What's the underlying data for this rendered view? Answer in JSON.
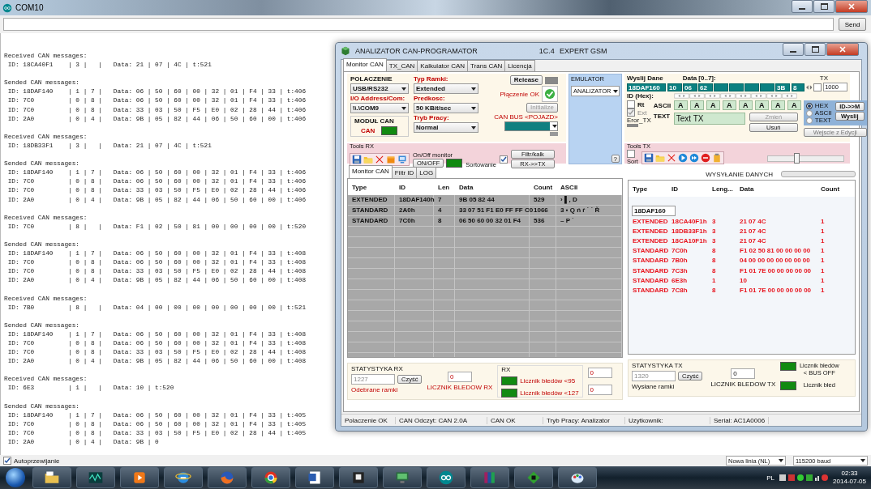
{
  "serial_monitor": {
    "title": "COM10",
    "send_button": "Send",
    "log": [
      {
        "header": "Received CAN messages:",
        "lines": [
          " ID: 18CA40F1    | 3 |   |   Data: 21 | 07 | 4C | t:521"
        ]
      },
      {
        "header": "Sended CAN messages:",
        "lines": [
          " ID: 18DAF140    | 1 | 7 |   Data: 06 | 50 | 60 | 00 | 32 | 01 | F4 | 33 | t:406",
          " ID: 7C0         | 0 | 8 |   Data: 06 | 50 | 60 | 00 | 32 | 01 | F4 | 33 | t:406",
          " ID: 7C0         | 0 | 8 |   Data: 33 | 03 | 50 | F5 | E0 | 02 | 28 | 44 | t:406",
          " ID: 2A0         | 0 | 4 |   Data: 9B | 05 | 82 | 44 | 06 | 50 | 60 | 00 | t:406"
        ]
      },
      {
        "header": "Received CAN messages:",
        "lines": [
          " ID: 18DB33F1    | 3 |   |   Data: 21 | 07 | 4C | t:521"
        ]
      },
      {
        "header": "Sended CAN messages:",
        "lines": [
          " ID: 18DAF140    | 1 | 7 |   Data: 06 | 50 | 60 | 00 | 32 | 01 | F4 | 33 | t:406",
          " ID: 7C0         | 0 | 8 |   Data: 06 | 50 | 60 | 00 | 32 | 01 | F4 | 33 | t:406",
          " ID: 7C0         | 0 | 8 |   Data: 33 | 03 | 50 | F5 | E0 | 02 | 28 | 44 | t:406",
          " ID: 2A0         | 0 | 4 |   Data: 9B | 05 | 82 | 44 | 06 | 50 | 60 | 00 | t:406"
        ]
      },
      {
        "header": "Received CAN messages:",
        "lines": [
          " ID: 7C0         | 8 |   |   Data: F1 | 02 | 50 | 81 | 00 | 00 | 00 | 00 | t:520"
        ]
      },
      {
        "header": "Sended CAN messages:",
        "lines": [
          " ID: 18DAF140    | 1 | 7 |   Data: 06 | 50 | 60 | 00 | 32 | 01 | F4 | 33 | t:408",
          " ID: 7C0         | 0 | 8 |   Data: 06 | 50 | 60 | 00 | 32 | 01 | F4 | 33 | t:408",
          " ID: 7C0         | 0 | 8 |   Data: 33 | 03 | 50 | F5 | E0 | 02 | 28 | 44 | t:408",
          " ID: 2A0         | 0 | 4 |   Data: 9B | 05 | 82 | 44 | 06 | 50 | 60 | 00 | t:408"
        ]
      },
      {
        "header": "Received CAN messages:",
        "lines": [
          " ID: 7B0         | 8 |   |   Data: 04 | 00 | 00 | 00 | 00 | 00 | 00 | 00 | t:521"
        ]
      },
      {
        "header": "Sended CAN messages:",
        "lines": [
          " ID: 18DAF140    | 1 | 7 |   Data: 06 | 50 | 60 | 00 | 32 | 01 | F4 | 33 | t:408",
          " ID: 7C0         | 0 | 8 |   Data: 06 | 50 | 60 | 00 | 32 | 01 | F4 | 33 | t:408",
          " ID: 7C0         | 0 | 8 |   Data: 33 | 03 | 50 | F5 | E0 | 02 | 28 | 44 | t:408",
          " ID: 2A0         | 0 | 4 |   Data: 9B | 05 | 82 | 44 | 06 | 50 | 60 | 00 | t:408"
        ]
      },
      {
        "header": "Received CAN messages:",
        "lines": [
          " ID: 6E3         | 1 |   |   Data: 10 | t:520"
        ]
      },
      {
        "header": "Sended CAN messages:",
        "lines": [
          " ID: 18DAF140    | 1 | 7 |   Data: 06 | 50 | 60 | 00 | 32 | 01 | F4 | 33 | t:405",
          " ID: 7C0         | 0 | 8 |   Data: 06 | 50 | 60 | 00 | 32 | 01 | F4 | 33 | t:405",
          " ID: 7C0         | 0 | 8 |   Data: 33 | 03 | 50 | F5 | E0 | 02 | 28 | 44 | t:405",
          " ID: 2A0         | 0 | 4 |   Data: 9B | 0"
        ]
      }
    ],
    "autoscroll": {
      "label": "Autoprzewijanie",
      "checked": true
    },
    "line_ending": "Nowa linia (NL)",
    "baud": "115200 baud"
  },
  "analyzer": {
    "title": "ANALIZATOR CAN-PROGRAMATOR",
    "version": "1C.4",
    "author": "EXPERT GSM",
    "tabs": [
      {
        "label": "Monitor CAN",
        "selected": true
      },
      {
        "label": "TX_CAN",
        "selected": false
      },
      {
        "label": "Kalkulator CAN",
        "selected": false
      },
      {
        "label": "Trans CAN",
        "selected": false
      },
      {
        "label": "Licencja",
        "selected": false
      }
    ],
    "connection": {
      "heading": "POLACZENIE",
      "port_type": "USB/RS232",
      "address_label": "I/O Address/Com:",
      "address": "\\\\.\\COM9",
      "module_label": "MODUŁ CAN",
      "can_label": "CAN",
      "can_led_on": true
    },
    "frame": {
      "type_label": "Typ Ramki:",
      "type": "Extended",
      "speed_label": "Predkosc:",
      "speed": "50 KBit/sec",
      "mode_label": "Tryb Pracy:",
      "mode": "Normal"
    },
    "release_button": "Release",
    "status_text": "Płączenie OK",
    "connected": true,
    "initialize_button": {
      "label": "Initialize",
      "disabled": true
    },
    "can_bus_label": "CAN BUS <POJAZD>",
    "emulator": {
      "heading": "EMULATOR",
      "mode": "ANALIZATOR",
      "help": "?"
    },
    "send": {
      "heading": "Wyslij Dane",
      "data_label": "Data [0..7]:",
      "tx_label": "TX",
      "id_value": "18DAF160",
      "bytes": [
        "10",
        "06",
        "62"
      ],
      "last_byte": "3B",
      "length": "8",
      "tx": {
        "checked": false
      },
      "interval": "1000",
      "id_hex_label": "ID (Hex):",
      "rt": {
        "label": "Rt",
        "checked": false
      },
      "ext": {
        "label": "Ext",
        "checked": true,
        "disabled": true
      },
      "error_tx": "Eror_TX",
      "ascii_label": "ASCII",
      "ascii_bytes": [
        "A",
        "A",
        "A",
        "A",
        "A",
        "A",
        "A",
        "A"
      ],
      "text_label": "TEXT",
      "text_value": "Text TX",
      "change_button": {
        "label": "Zmień",
        "disabled": true
      },
      "delete_button": "Usuń",
      "formats": [
        {
          "label": "HEX",
          "selected": true
        },
        {
          "label": "ASCII",
          "selected": false
        },
        {
          "label": "TEXT",
          "selected": false
        }
      ],
      "id_to_m_button": "ID->>M",
      "send_button": "Wyslij",
      "exit_edit_button": "Wejscie z Edycji"
    },
    "tools_rx": {
      "heading": "Tools RX",
      "icons": [
        {
          "kind": "save"
        },
        {
          "kind": "folder"
        },
        {
          "kind": "delete"
        },
        {
          "kind": "box"
        },
        {
          "kind": "monitor"
        }
      ],
      "monitor_label": "On/Off monitor",
      "onoff_button": "ON/OFF",
      "monitor_on": true,
      "sort_label": "Sortowanie",
      "sort_checked": true,
      "filter_button": "Filtr/kalk",
      "rx_tx_button": "RX->>TX"
    },
    "tools_tx": {
      "heading": "Tools TX",
      "sort_label": "Sort",
      "sort_checked": false,
      "icons": [
        {
          "kind": "save"
        },
        {
          "kind": "folder"
        },
        {
          "kind": "delete"
        },
        {
          "kind": "play"
        },
        {
          "kind": "fast_forward"
        },
        {
          "kind": "stop"
        },
        {
          "kind": "clipboard"
        }
      ],
      "slider": {
        "level": 0.38
      }
    },
    "rx_tabs": [
      {
        "label": "Monitor CAN",
        "selected": true
      },
      {
        "label": "Filtr ID",
        "selected": false
      },
      {
        "label": "LOG",
        "selected": false
      }
    ],
    "rx_table": {
      "columns": [
        "Type",
        "ID",
        "Len",
        "Data",
        "Count",
        "ASCII"
      ],
      "rows": [
        [
          "EXTENDED",
          "18DAF140h",
          "7",
          "9B 05 82 44",
          "529",
          "› ▌, D"
        ],
        [
          "STANDARD",
          "2A0h",
          "4",
          "33 07 51 F1 E0 FF FF C0",
          "1066",
          "3 ▪ Q ń ŕ ˙ ˙ Ř"
        ],
        [
          "STANDARD",
          "7C0h",
          "8",
          "06 50 60 00 32 01 F4",
          "536",
          "– P ˙"
        ]
      ]
    },
    "tx_progress": {
      "label": "WYSYŁANIE DANYCH",
      "level": 0
    },
    "tx_table": {
      "columns": [
        "Type",
        "ID",
        "Leng...",
        "Data",
        "Count"
      ],
      "edit_value": "18DAF160",
      "rows": [
        [
          "EXTENDED",
          "18CA40F1h",
          "3",
          "21 07 4C",
          "1"
        ],
        [
          "EXTENDED",
          "18DB33F1h",
          "3",
          "21 07 4C",
          "1"
        ],
        [
          "EXTENDED",
          "18CA10F1h",
          "3",
          "21 07 4C",
          "1"
        ],
        [
          "STANDARD",
          "7C0h",
          "8",
          "F1 02 50 81 00 00 00 00",
          "1"
        ],
        [
          "STANDARD",
          "7B0h",
          "8",
          "04 00 00 00 00 00 00 00",
          "1"
        ],
        [
          "STANDARD",
          "7C3h",
          "8",
          "F1 01 7E 00 00 00 00 00",
          "1"
        ],
        [
          "STANDARD",
          "6E3h",
          "1",
          "10",
          "1"
        ],
        [
          "STANDARD",
          "7C8h",
          "8",
          "F1 01 7E 00 00 00 00 00",
          "1"
        ]
      ]
    },
    "rx_stats": {
      "heading": "STATYSTYKA RX",
      "frames": "1227",
      "clear_button": "Czyść",
      "frames_label": "Odebrane ramki",
      "errors": "0",
      "errors_label": "LICZNIK BLEDOW RX",
      "rx_label": "RX",
      "counters": [
        {
          "label": "Licznik błedów <95",
          "value": "0",
          "on": true
        },
        {
          "label": "Licznik błedów <127",
          "value": "0",
          "on": true
        }
      ]
    },
    "tx_stats": {
      "heading": "STATYSTYKA TX",
      "frames": "1320",
      "clear_button": "Czyść",
      "frames_label": "Wysłane ramki",
      "errors": "0",
      "errors_label": "LICZNIK BLEDOW TX",
      "counters": [
        {
          "label": "Licznik błedów < BUS OFF",
          "on": true
        },
        {
          "label": "Licznik błed",
          "on": true
        }
      ]
    },
    "status_bar": [
      "Polaczenie OK",
      "CAN Odczyt: CAN 2.0A",
      "CAN OK",
      "Tryb Pracy: Analizator",
      "Uzytkownik:",
      "Serial: AC1A0006"
    ]
  },
  "taskbar": {
    "apps": [
      {
        "kind": "folder"
      },
      {
        "kind": "scope"
      },
      {
        "kind": "player"
      },
      {
        "kind": "ie"
      },
      {
        "kind": "firefox"
      },
      {
        "kind": "chrome"
      },
      {
        "kind": "word"
      },
      {
        "kind": "tile"
      },
      {
        "kind": "monitor"
      },
      {
        "kind": "arduino"
      },
      {
        "kind": "archive"
      },
      {
        "kind": "chip"
      },
      {
        "kind": "paint"
      }
    ],
    "language": "PL",
    "time": "02:33",
    "date": "2014-07-05"
  }
}
